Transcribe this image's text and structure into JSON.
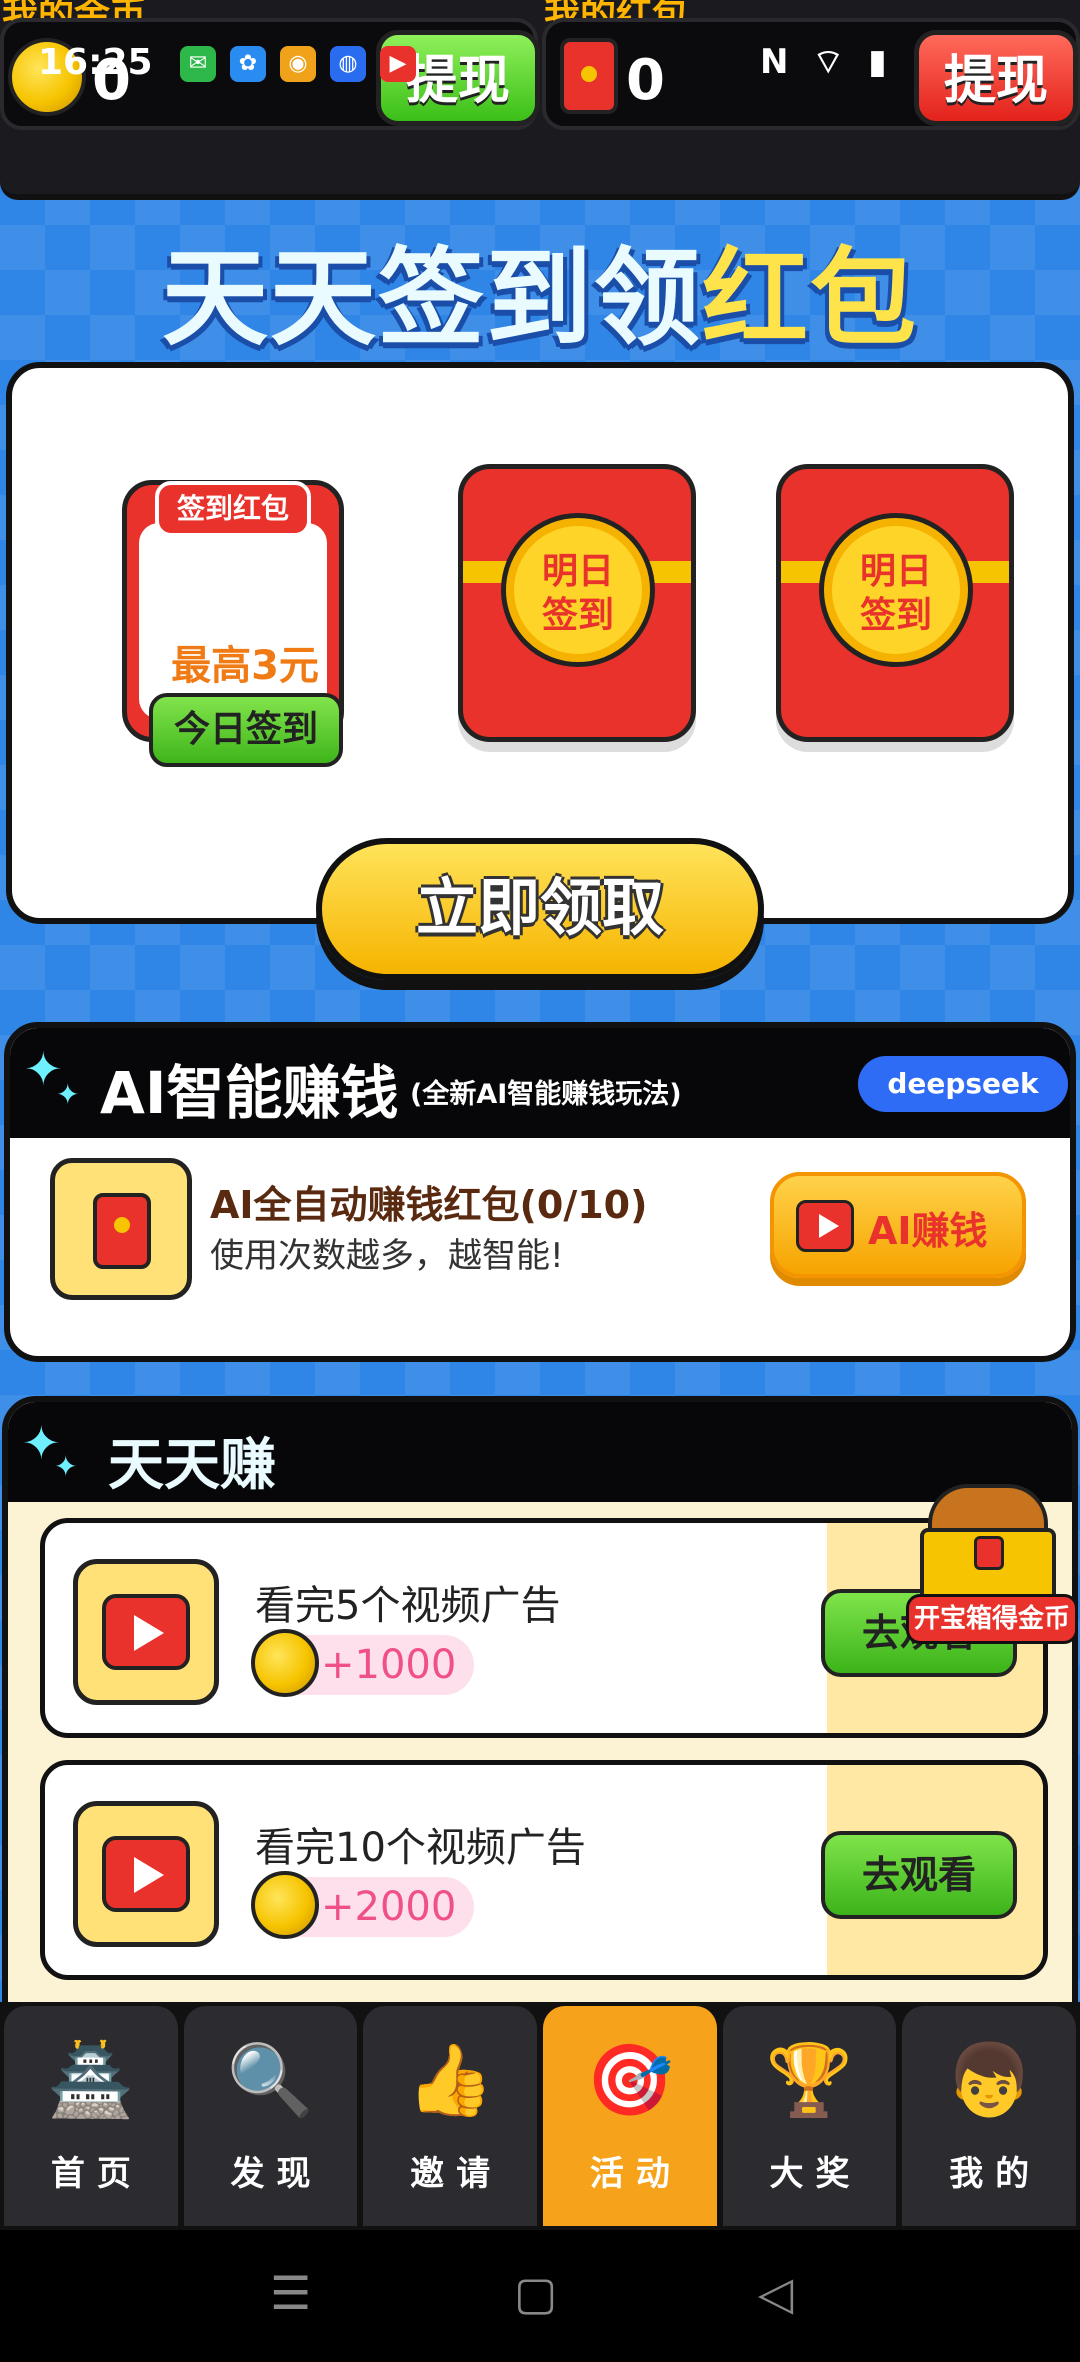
{
  "status_bar": {
    "time": "16:25",
    "right": "N ⌔ ▮"
  },
  "wallet": {
    "coins_label": "我的金币",
    "coins_value": "0",
    "coins_withdraw": "提现",
    "redpacket_label": "我的红包",
    "redpacket_value": "0",
    "redpacket_withdraw": "提现"
  },
  "banner": {
    "title_part1": "天天签到领",
    "title_part2": "红包"
  },
  "signin": {
    "today_tag": "签到红包",
    "today_max": "最高3元",
    "today_button": "今日签到",
    "day2_line1": "明日",
    "day2_line2": "签到",
    "day3_line1": "明日",
    "day3_line2": "签到",
    "claim_button": "立即领取"
  },
  "ai_section": {
    "title": "AI智能赚钱",
    "subtitle": "(全新AI智能赚钱玩法)",
    "badge": "deepseek",
    "task_title": "AI全自动赚钱红包(0/10)",
    "task_desc": "使用次数越多，越智能!",
    "button": "AI赚钱"
  },
  "earn_section": {
    "title": "天天赚",
    "tasks": [
      {
        "name": "看完5个视频广告",
        "reward": "+1000",
        "button": "去观看"
      },
      {
        "name": "看完10个视频广告",
        "reward": "+2000",
        "button": "去观看"
      }
    ],
    "chest_label": "开宝箱得金币"
  },
  "nav": [
    {
      "label": "首页",
      "icon": "temple-icon"
    },
    {
      "label": "发现",
      "icon": "magnifier-icon"
    },
    {
      "label": "邀请",
      "icon": "hand-icon"
    },
    {
      "label": "活动",
      "icon": "target-icon"
    },
    {
      "label": "大奖",
      "icon": "trophy-icon"
    },
    {
      "label": "我的",
      "icon": "avatar-icon"
    }
  ],
  "colors": {
    "accent_green": "#3bbf18",
    "accent_red": "#e8322b",
    "accent_yellow": "#f6c400",
    "nav_active": "#f7a21b"
  }
}
